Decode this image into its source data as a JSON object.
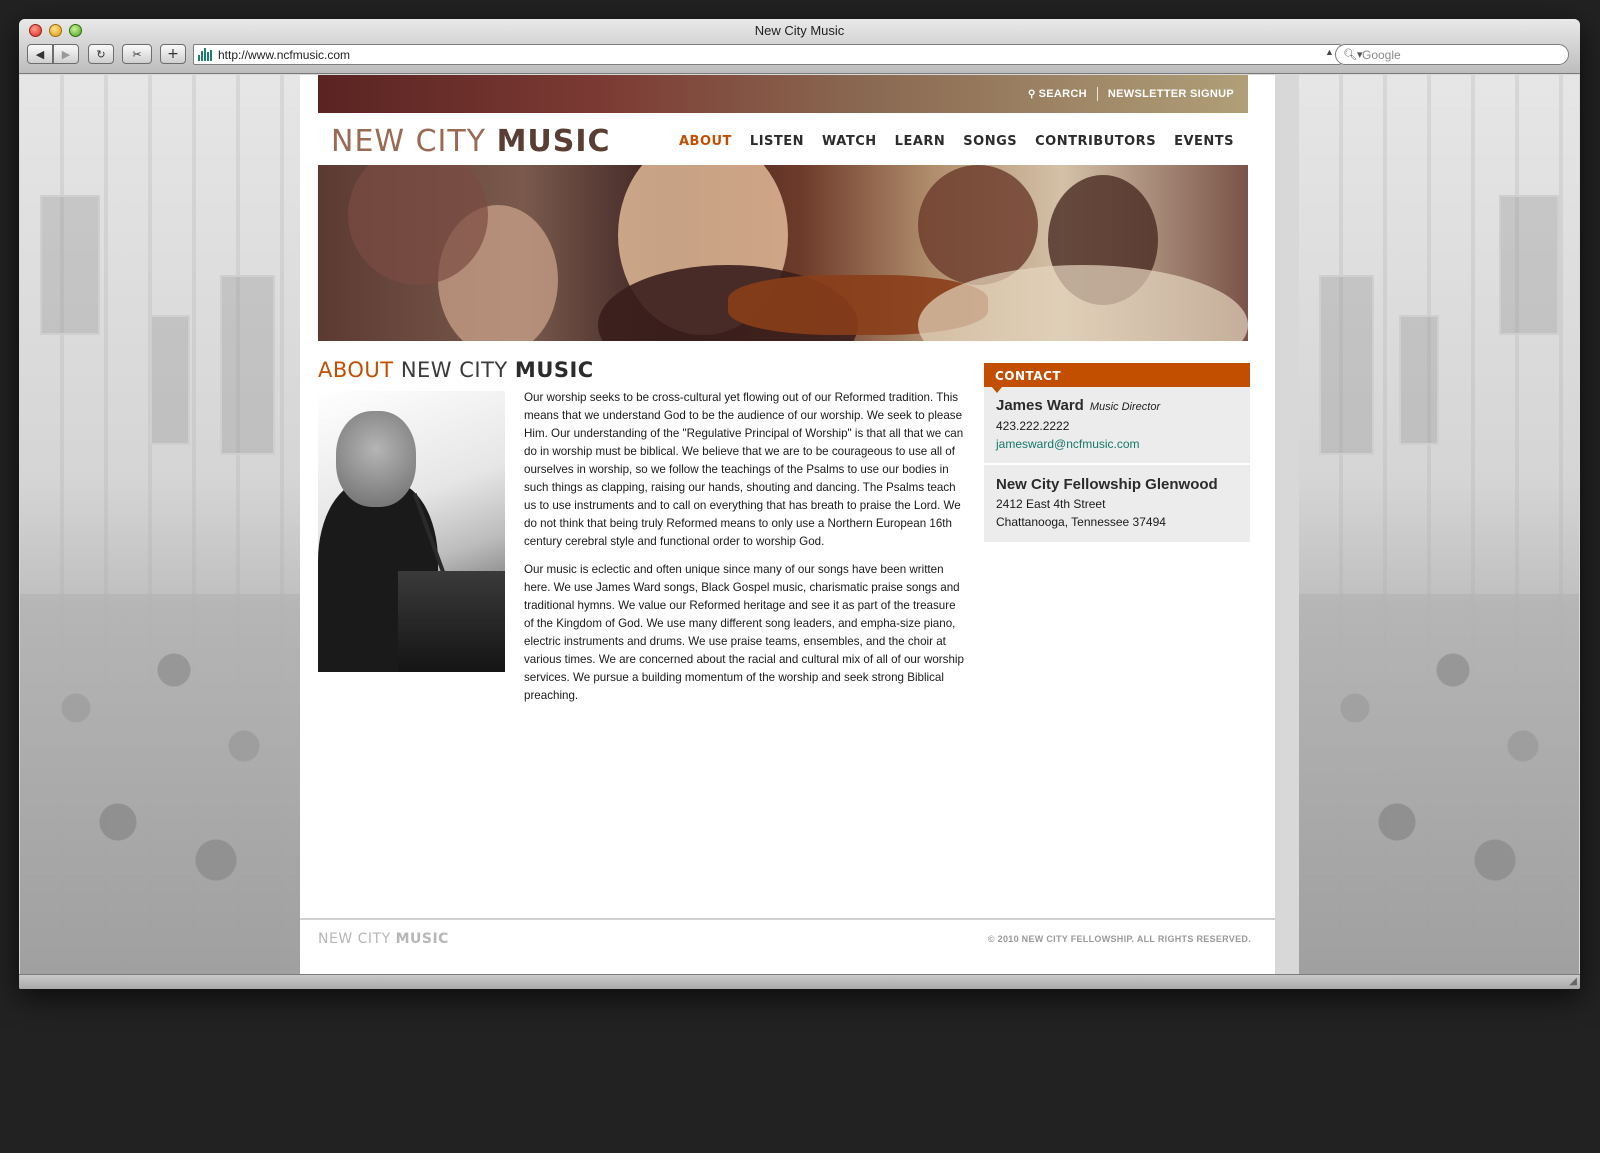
{
  "browser": {
    "window_title": "New City Music",
    "url": "http://www.ncfmusic.com",
    "search_placeholder": "Google"
  },
  "site": {
    "top_links": {
      "search": "SEARCH",
      "newsletter": "NEWSLETTER SIGNUP"
    },
    "logo": {
      "part1": "NEW CITY ",
      "part2": "MUSIC"
    },
    "nav": [
      {
        "label": "ABOUT",
        "active": true
      },
      {
        "label": "LISTEN",
        "active": false
      },
      {
        "label": "WATCH",
        "active": false
      },
      {
        "label": "LEARN",
        "active": false
      },
      {
        "label": "SONGS",
        "active": false
      },
      {
        "label": "CONTRIBUTORS",
        "active": false
      },
      {
        "label": "EVENTS",
        "active": false
      }
    ],
    "about": {
      "title_accent": "ABOUT",
      "title_mid": " NEW CITY ",
      "title_bold": "MUSIC",
      "paragraphs": [
        "Our worship seeks to be cross-cultural yet flowing out of our Reformed tradition. This means that we understand God to be the audience of our worship. We seek to please Him. Our understanding of the \"Regulative Principal of Worship\" is that all that we can do in worship must be biblical. We believe that we are to be courageous to use all of ourselves in worship, so we follow the teachings of the Psalms to use our bodies in such things as clapping, raising our hands, shouting and dancing. The Psalms teach us to use instruments and to call on everything that has breath to praise the Lord. We do not think that being truly Reformed means to only use a Northern European 16th century cerebral style and functional order to worship God.",
        "Our music is eclectic and often unique since many of our songs have been written here. We use James Ward songs, Black Gospel music, charismatic praise songs and traditional hymns. We value our Reformed heritage and see it as part of the treasure of the Kingdom of God. We use many different song leaders, and empha-size piano, electric instruments and drums. We use praise teams, ensembles, and the choir at various times. We are concerned about the racial and cultural mix of all of our worship services. We pursue a building momentum of the worship and seek strong Biblical preaching."
      ]
    },
    "contact": {
      "header": "CONTACT",
      "person_name": "James Ward",
      "person_role": "Music Director",
      "phone": "423.222.2222",
      "email": "jamesward@ncfmusic.com",
      "org_name": "New City Fellowship Glenwood",
      "address_line1": "2412 East 4th Street",
      "address_line2": "Chattanooga, Tennessee 37494"
    },
    "footer": {
      "logo_part1": "NEW CITY ",
      "logo_part2": "MUSIC",
      "copyright": "© 2010 NEW CITY FELLOWSHIP. ALL RIGHTS RESERVED."
    }
  },
  "colors": {
    "accent": "#c24e00",
    "link": "#16776a",
    "contact_bg": "#ececec"
  }
}
